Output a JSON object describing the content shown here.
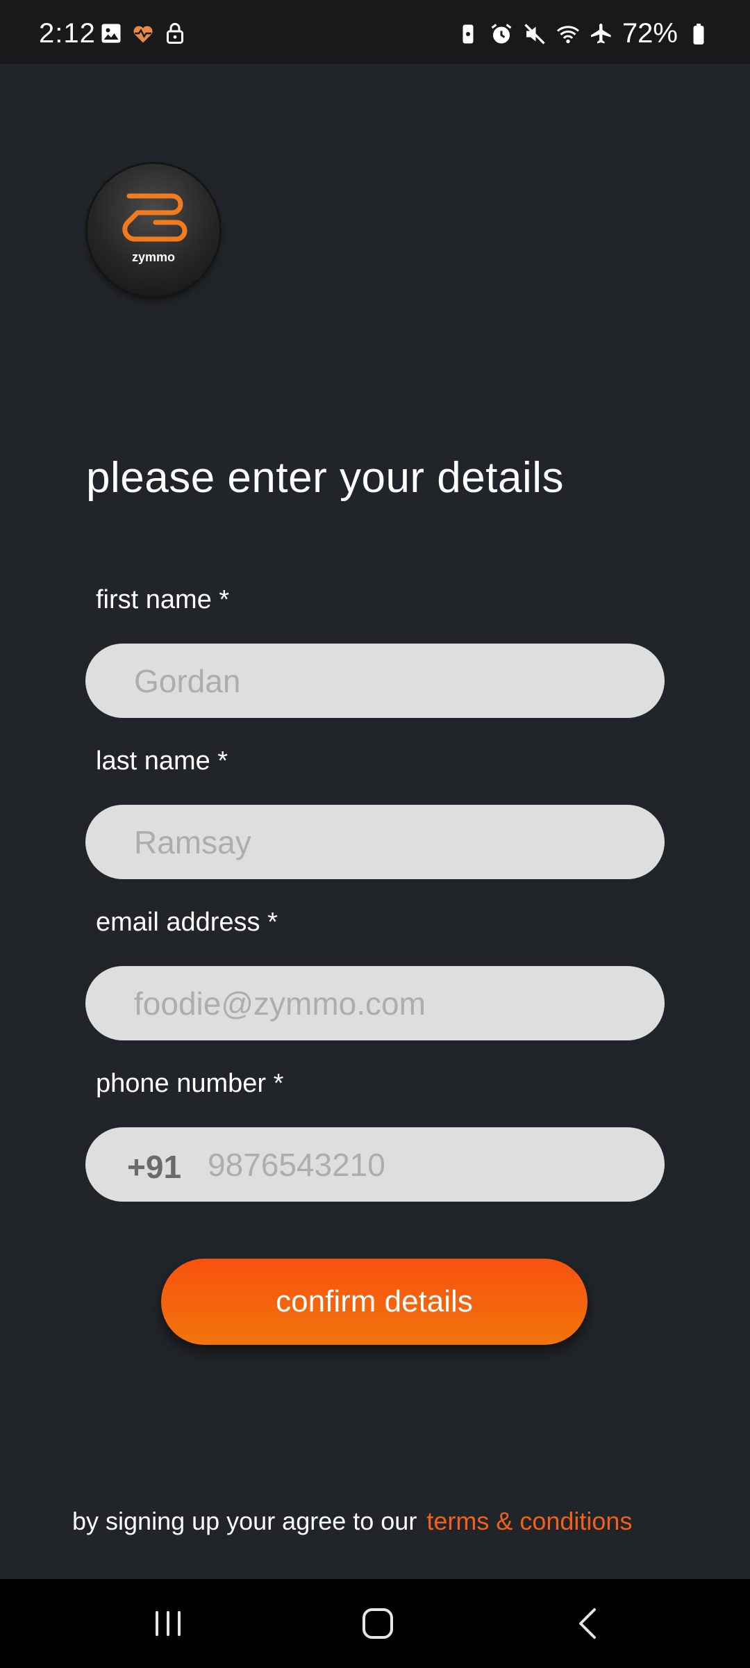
{
  "status_bar": {
    "time": "2:12",
    "battery": "72%",
    "left_icons": [
      "image-icon",
      "heart-icon",
      "lock-icon"
    ],
    "right_icons": [
      "battery-saver-icon",
      "alarm-icon",
      "mute-icon",
      "wifi-icon",
      "airplane-icon",
      "battery-icon"
    ]
  },
  "logo": {
    "text": "zymmo",
    "accent_color": "#f47a20"
  },
  "page_title": "please enter your details",
  "form": {
    "first_name": {
      "label": "first name *",
      "value": "",
      "placeholder": "Gordan"
    },
    "last_name": {
      "label": "last name *",
      "value": "",
      "placeholder": "Ramsay"
    },
    "email": {
      "label": "email address *",
      "value": "",
      "placeholder": "foodie@zymmo.com"
    },
    "phone": {
      "label": "phone number *",
      "prefix": "+91",
      "value": "",
      "placeholder": "9876543210"
    }
  },
  "confirm_button": {
    "label": "confirm details",
    "color_start": "#f7520f",
    "color_end": "#f2740c"
  },
  "footer": {
    "text": "by signing up your agree to our",
    "link": "terms & conditions",
    "link_color": "#f2601a"
  },
  "nav_bar": {
    "buttons": [
      "recents-icon",
      "home-icon",
      "back-icon"
    ]
  }
}
